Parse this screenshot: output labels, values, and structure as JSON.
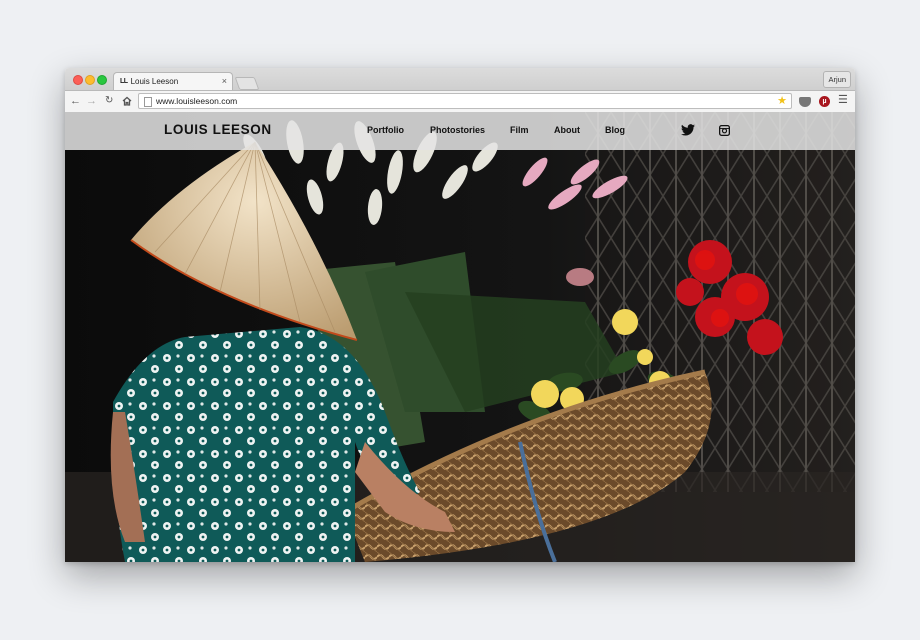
{
  "browser": {
    "tab_title": "Louis Leeson",
    "tab_favicon": "LL",
    "close_glyph": "×",
    "profile_name": "Arjun",
    "url": "www.louisleeson.com"
  },
  "icons": {
    "back": "back-arrow-icon",
    "forward": "forward-arrow-icon",
    "reload": "reload-icon",
    "home": "home-icon",
    "bookmark": "star-icon",
    "pocket": "pocket-icon",
    "ublock": "ublock-icon",
    "menu": "hamburger-menu-icon",
    "twitter": "twitter-icon",
    "instagram": "instagram-icon"
  },
  "site": {
    "logo": "LOUIS LEESON",
    "nav": [
      "Portfolio",
      "Photostories",
      "Film",
      "About",
      "Blog"
    ]
  },
  "hero": {
    "subject": "vendor-with-conical-hat-and-flower-basket"
  },
  "colors": {
    "nav_bg": "#e4e4e4",
    "close": "#fc5f57",
    "minimize": "#fdbc2e",
    "maximize": "#29c73f",
    "bookmark_star": "#f2c218"
  }
}
